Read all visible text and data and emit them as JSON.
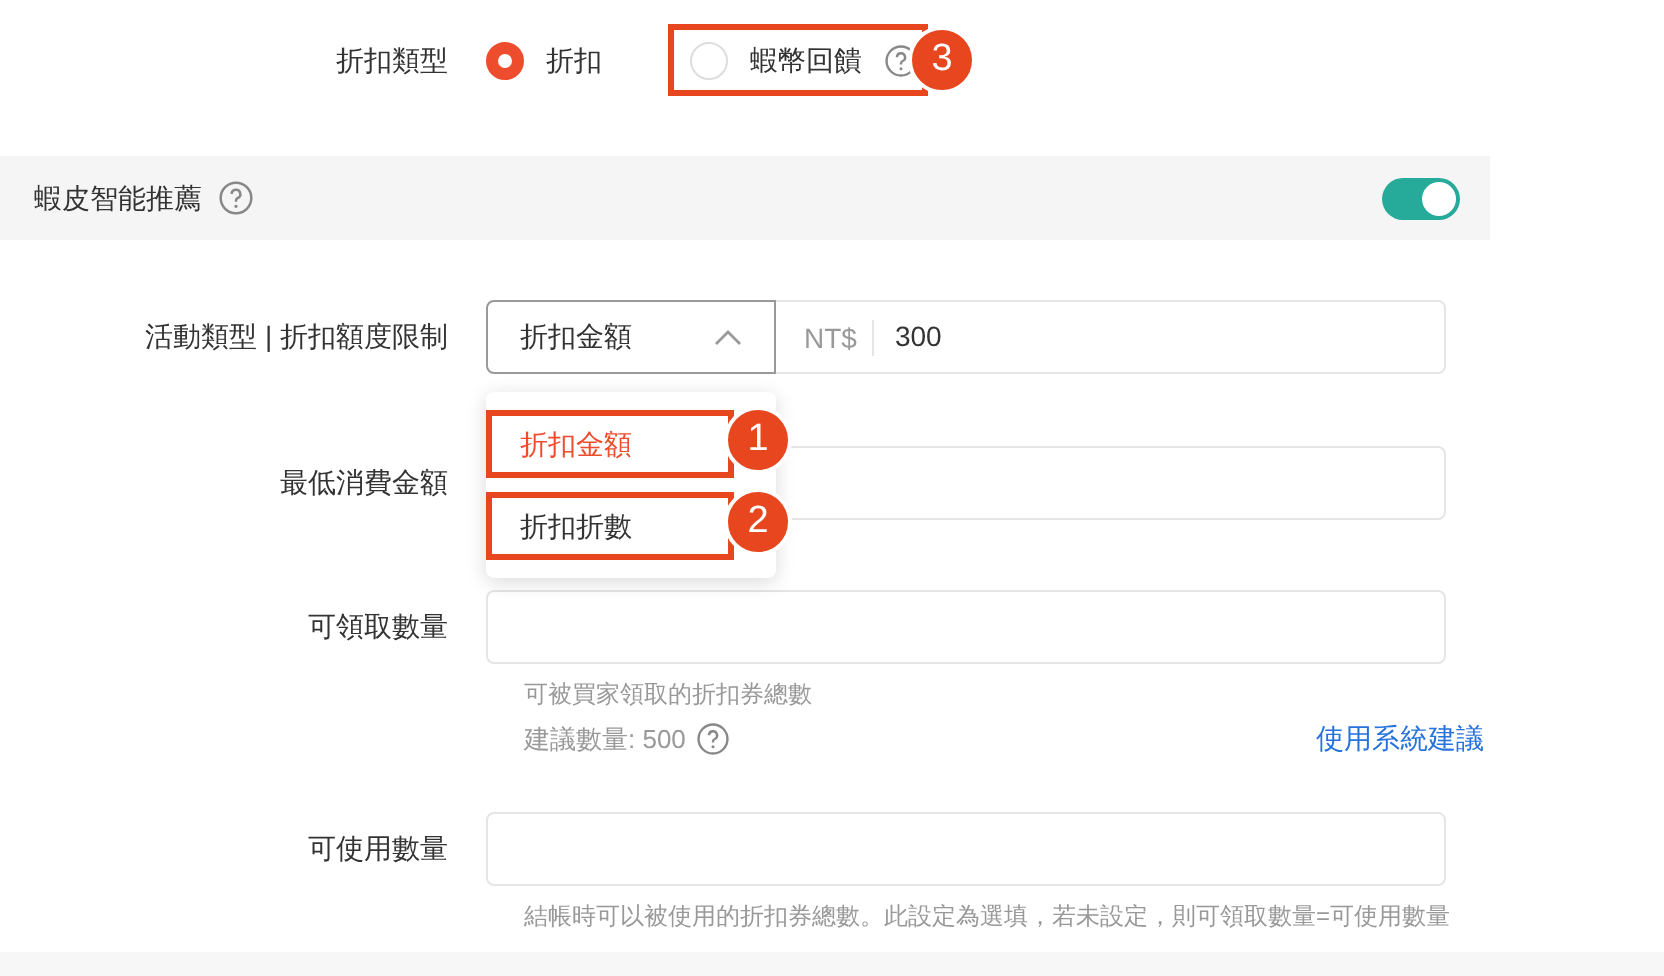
{
  "discount_type": {
    "label": "折扣類型",
    "options": [
      {
        "label": "折扣",
        "selected": true
      },
      {
        "label": "蝦幣回饋",
        "selected": false,
        "help": true,
        "marker": "3"
      }
    ]
  },
  "section": {
    "title": "蝦皮智能推薦",
    "on": true
  },
  "fields": [
    {
      "kind": "select_amount",
      "label": "活動類型 | 折扣額度限制",
      "select_value": "折扣金額",
      "expanded": true,
      "currency": "NT$",
      "value": "300",
      "menu": [
        {
          "label": "折扣金額",
          "selected": true,
          "marker": "1"
        },
        {
          "label": "折扣折數",
          "selected": false,
          "marker": "2"
        }
      ]
    },
    {
      "kind": "text",
      "label": "最低消費金額"
    },
    {
      "kind": "text",
      "label": "可領取數量",
      "hint": "可被買家領取的折扣券總數",
      "suggestion": "建議數量: 500",
      "link": "使用系統建議"
    },
    {
      "kind": "text",
      "label": "可使用數量",
      "hint": "結帳時可以被使用的折扣券總數。此設定為選填，若未設定，則可領取數量=可使用數量"
    }
  ]
}
